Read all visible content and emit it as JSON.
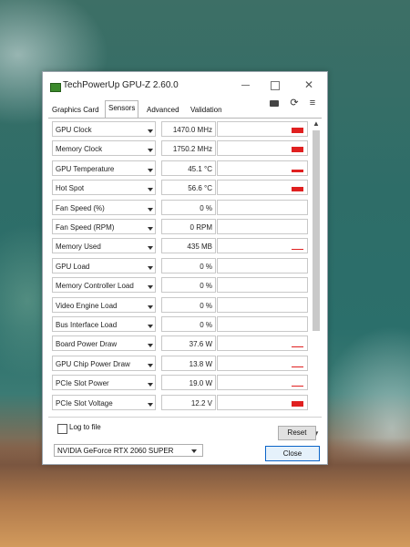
{
  "window": {
    "title": "TechPowerUp GPU-Z 2.60.0"
  },
  "tabs": [
    {
      "label": "Graphics Card",
      "active": false
    },
    {
      "label": "Sensors",
      "active": true
    },
    {
      "label": "Advanced",
      "active": false
    },
    {
      "label": "Validation",
      "active": false
    }
  ],
  "toolbar_icons": [
    "camera-icon",
    "refresh-icon",
    "menu-icon"
  ],
  "sensors": [
    {
      "name": "GPU Clock",
      "value": "1470.0 MHz",
      "graph_level": 0.45
    },
    {
      "name": "Memory Clock",
      "value": "1750.2 MHz",
      "graph_level": 0.45
    },
    {
      "name": "GPU Temperature",
      "value": "45.1 °C",
      "graph_level": 0.2
    },
    {
      "name": "Hot Spot",
      "value": "56.6 °C",
      "graph_level": 0.35
    },
    {
      "name": "Fan Speed (%)",
      "value": "0 %",
      "graph_level": 0
    },
    {
      "name": "Fan Speed (RPM)",
      "value": "0 RPM",
      "graph_level": 0
    },
    {
      "name": "Memory Used",
      "value": "435 MB",
      "graph_level": 0.05
    },
    {
      "name": "GPU Load",
      "value": "0 %",
      "graph_level": 0
    },
    {
      "name": "Memory Controller Load",
      "value": "0 %",
      "graph_level": 0
    },
    {
      "name": "Video Engine Load",
      "value": "0 %",
      "graph_level": 0
    },
    {
      "name": "Bus Interface Load",
      "value": "0 %",
      "graph_level": 0
    },
    {
      "name": "Board Power Draw",
      "value": "37.6 W",
      "graph_level": 0.1
    },
    {
      "name": "GPU Chip Power Draw",
      "value": "13.8 W",
      "graph_level": 0.1
    },
    {
      "name": "PCIe Slot Power",
      "value": "19.0 W",
      "graph_level": 0.1
    },
    {
      "name": "PCIe Slot Voltage",
      "value": "12.2 V",
      "graph_level": 0.45
    }
  ],
  "footer": {
    "log_label": "Log to file",
    "log_checked": false,
    "reset_label": "Reset",
    "gpu_selected": "NVIDIA GeForce RTX 2060 SUPER",
    "close_label": "Close"
  },
  "colors": {
    "graph": "#e02020",
    "close_border": "#0a64c8"
  }
}
